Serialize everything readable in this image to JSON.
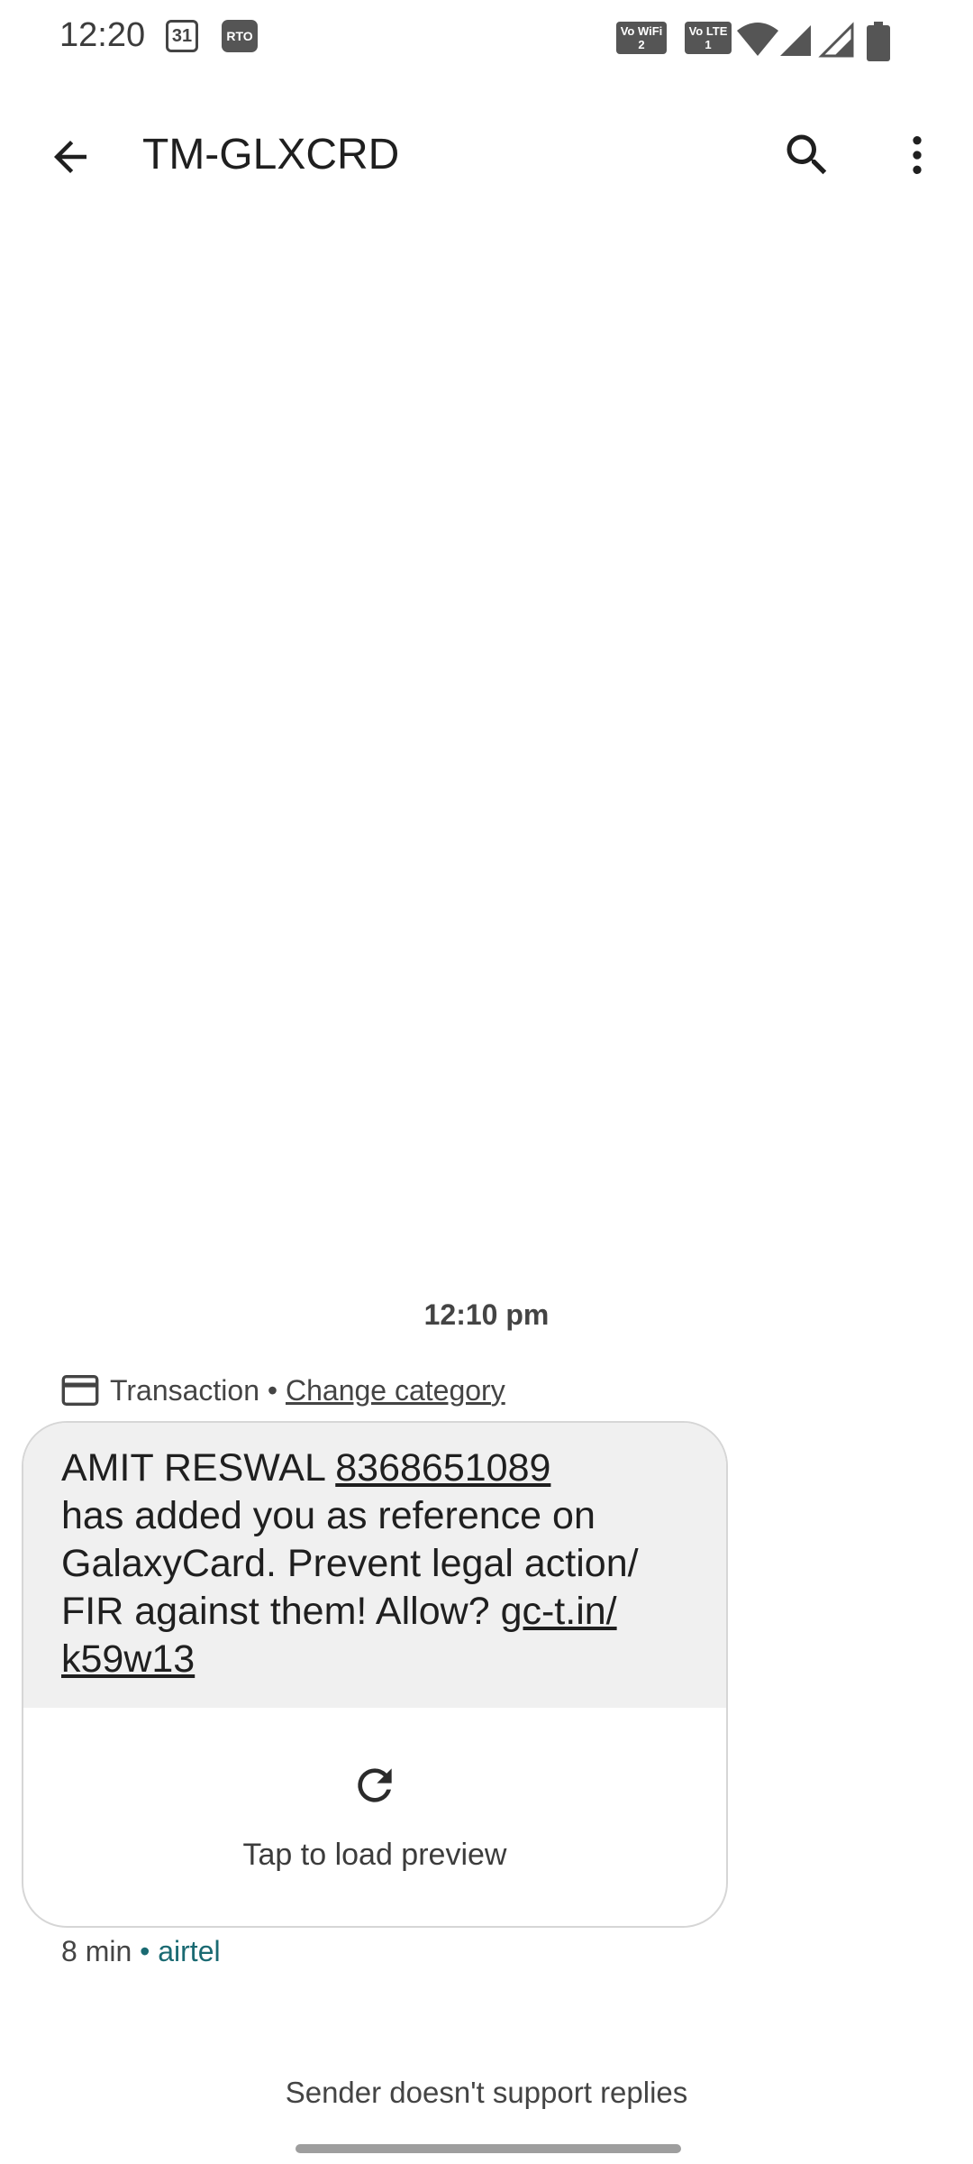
{
  "status_bar": {
    "time": "12:20",
    "calendar_day": "31",
    "rto_label": "RTO",
    "vowifi_label": "Vo WiFi 2",
    "volte_label": "Vo LTE 1"
  },
  "app_bar": {
    "title": "TM-GLXCRD"
  },
  "conversation": {
    "timestamp": "12:10 pm",
    "category_label": "Transaction",
    "category_separator": " • ",
    "change_category": "Change category",
    "message": {
      "sender_name": "AMIT RESWAL",
      "phone": "8368651089",
      "body": "has added you as reference on GalaxyCard. Prevent legal action/ FIR against them! Allow?",
      "link": "gc-t.in/ k59w13"
    },
    "preview_label": "Tap to load preview",
    "age": "8 min",
    "meta_separator": " • ",
    "carrier": "airtel",
    "reply_notice": "Sender doesn't support replies"
  },
  "icons": [
    "calendar-icon",
    "rto-icon",
    "wifi-icon",
    "signal-icon",
    "battery-icon",
    "back-arrow-icon",
    "search-icon",
    "more-vert-icon",
    "credit-card-icon",
    "refresh-icon"
  ]
}
